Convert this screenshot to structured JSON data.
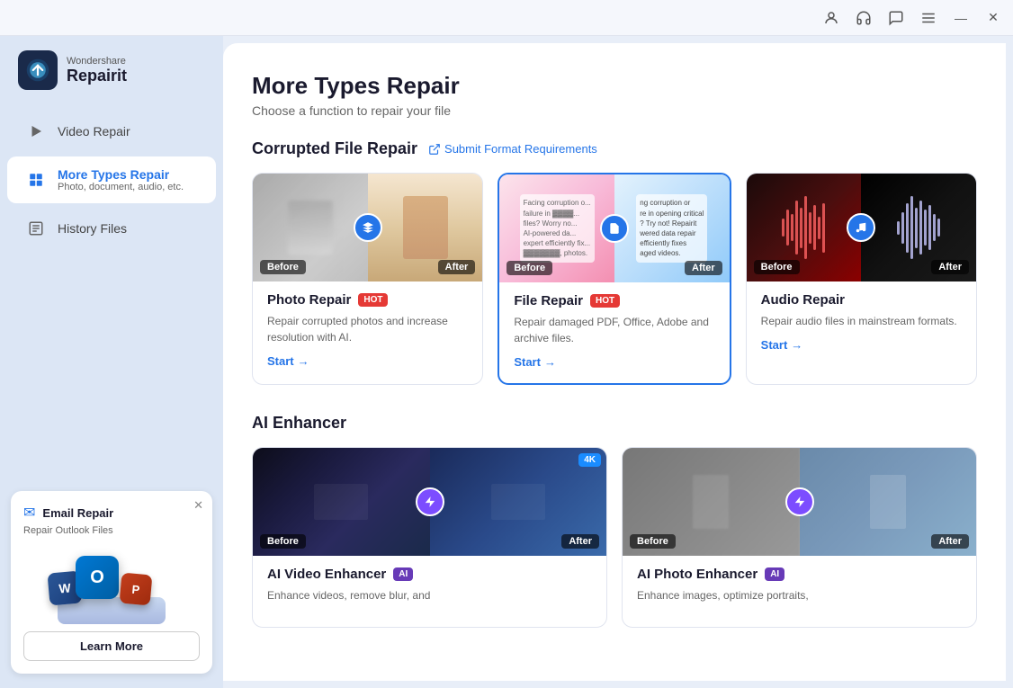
{
  "titlebar": {
    "icons": [
      "user-icon",
      "headphone-icon",
      "chat-icon",
      "menu-icon",
      "minimize-icon",
      "close-icon"
    ]
  },
  "logo": {
    "brand": "Wondershare",
    "name": "Repairit"
  },
  "nav": {
    "items": [
      {
        "id": "video-repair",
        "label": "Video Repair",
        "sub": "",
        "active": false
      },
      {
        "id": "more-types-repair",
        "label": "More Types Repair",
        "sub": "Photo, document, audio, etc.",
        "active": true
      },
      {
        "id": "history-files",
        "label": "History Files",
        "sub": "",
        "active": false
      }
    ]
  },
  "promo": {
    "title": "Email Repair",
    "sub": "Repair Outlook Files",
    "learn_more_label": "Learn More"
  },
  "main": {
    "title": "More Types Repair",
    "subtitle": "Choose a function to repair your file",
    "corrupted_section": {
      "title": "Corrupted File Repair",
      "submit_link_label": "Submit Format Requirements",
      "cards": [
        {
          "id": "photo-repair",
          "title": "Photo Repair",
          "badge": "HOT",
          "desc": "Repair corrupted photos and increase resolution with AI.",
          "start_label": "Start"
        },
        {
          "id": "file-repair",
          "title": "File Repair",
          "badge": "HOT",
          "desc": "Repair damaged PDF, Office, Adobe and archive files.",
          "start_label": "Start",
          "selected": true
        },
        {
          "id": "audio-repair",
          "title": "Audio Repair",
          "badge": "",
          "desc": "Repair audio files in mainstream formats.",
          "start_label": "Start"
        }
      ]
    },
    "ai_section": {
      "title": "AI Enhancer",
      "cards": [
        {
          "id": "ai-video-enhancer",
          "title": "AI Video Enhancer",
          "badge": "AI",
          "extra_badge": "4K",
          "desc": "Enhance videos, remove blur, and"
        },
        {
          "id": "ai-photo-enhancer",
          "title": "AI Photo Enhancer",
          "badge": "AI",
          "desc": "Enhance images, optimize portraits,"
        }
      ]
    }
  }
}
